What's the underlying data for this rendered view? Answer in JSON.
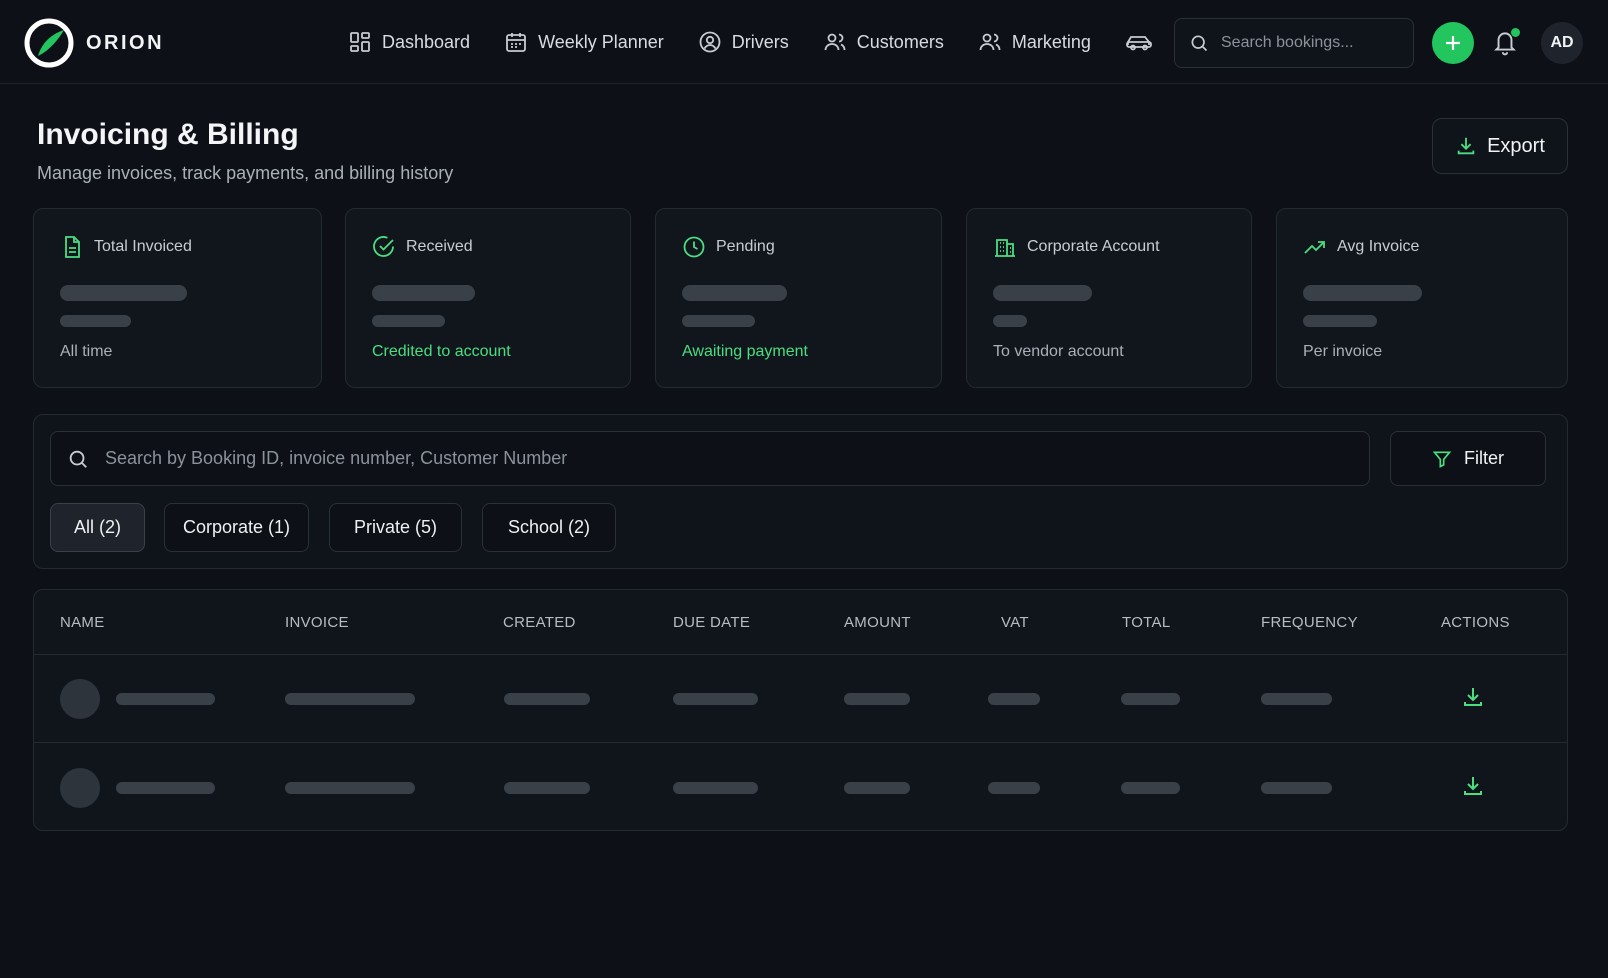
{
  "app": {
    "name": "ORION"
  },
  "nav": {
    "items": [
      {
        "label": "Dashboard",
        "icon": "dashboard-grid-icon"
      },
      {
        "label": "Weekly Planner",
        "icon": "calendar-icon"
      },
      {
        "label": "Drivers",
        "icon": "user-circle-icon"
      },
      {
        "label": "Customers",
        "icon": "users-icon"
      },
      {
        "label": "Marketing",
        "icon": "users-icon"
      }
    ],
    "extra_icon": "car-icon"
  },
  "top_search": {
    "placeholder": "Search bookings..."
  },
  "user": {
    "initials": "AD"
  },
  "header": {
    "title": "Invoicing & Billing",
    "subtitle": "Manage invoices, track payments, and billing history",
    "export_label": "Export"
  },
  "stats": [
    {
      "label": "Total Invoiced",
      "icon": "document-icon",
      "caption": "All time",
      "caption_color": "muted"
    },
    {
      "label": "Received",
      "icon": "check-circle-icon",
      "caption": "Credited to account",
      "caption_color": "green"
    },
    {
      "label": "Pending",
      "icon": "clock-icon",
      "caption": "Awaiting payment",
      "caption_color": "green"
    },
    {
      "label": "Corporate Account",
      "icon": "building-icon",
      "caption": "To vendor account",
      "caption_color": "muted"
    },
    {
      "label": "Avg Invoice",
      "icon": "trending-up-icon",
      "caption": "Per invoice",
      "caption_color": "muted"
    }
  ],
  "filters": {
    "search_placeholder": "Search by Booking ID, invoice number, Customer Number",
    "filter_label": "Filter",
    "tabs": [
      {
        "label": "All (2)",
        "active": true
      },
      {
        "label": "Corporate (1)",
        "active": false
      },
      {
        "label": "Private (5)",
        "active": false
      },
      {
        "label": "School (2)",
        "active": false
      }
    ]
  },
  "table": {
    "columns": [
      "NAME",
      "INVOICE",
      "CREATED",
      "DUE DATE",
      "AMOUNT",
      "VAT",
      "TOTAL",
      "FREQUENCY",
      "ACTIONS"
    ],
    "row_count": 2,
    "rows_state": "loading"
  },
  "colors": {
    "background": "#0d1117",
    "accent": "#22c55e",
    "accent_text": "#4ade80",
    "skeleton": "#3a4048"
  }
}
